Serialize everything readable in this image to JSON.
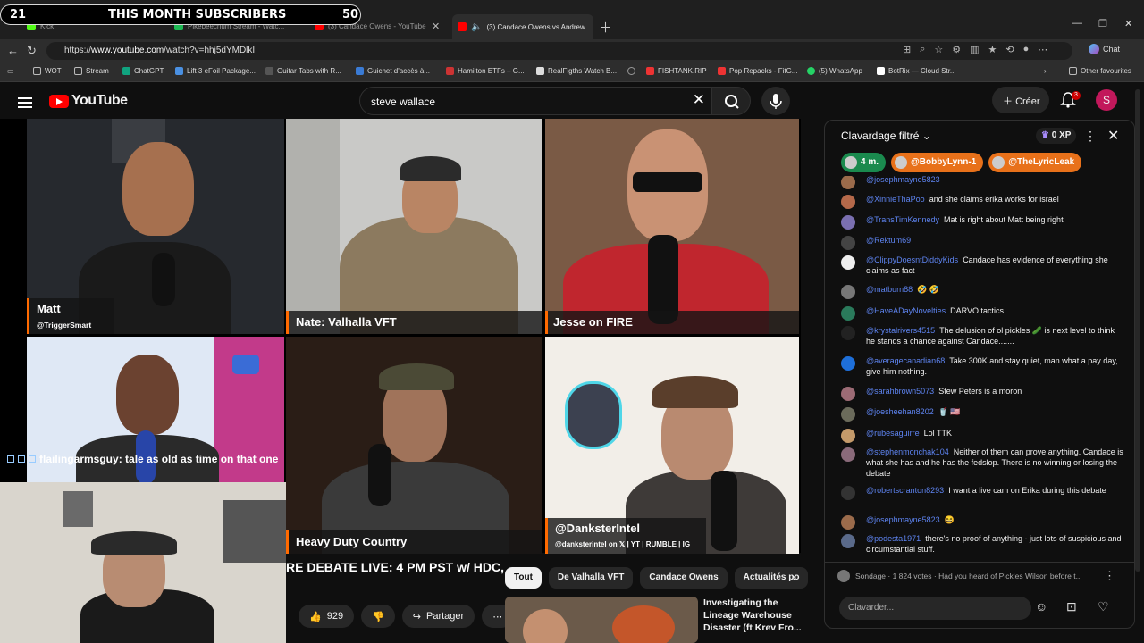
{
  "subscriber_overlay": {
    "left_count": "21",
    "title": "THIS MONTH SUBSCRIBERS",
    "right_count": "50"
  },
  "tabs": [
    {
      "label": "Kick",
      "fav_color": "#53fc18"
    },
    {
      "label": "Pikebeechum Stream - Watc...",
      "fav_color": "#1db954"
    },
    {
      "label": "(3) Candace Owens - YouTube",
      "fav_color": "#ff0000"
    },
    {
      "label": "(3) Candace Owens vs Andrew...",
      "fav_color": "#ff0000"
    }
  ],
  "address_bar": {
    "url_prefix": "https://",
    "url_site": "www.youtube.com",
    "url_rest": "/watch?v=hhj5dYMDlkI",
    "chat_label": "Chat"
  },
  "bookmarks": [
    {
      "label": "WOT",
      "color": "#888"
    },
    {
      "label": "Stream",
      "color": "#888"
    },
    {
      "label": "ChatGPT",
      "color": "#10a37f"
    },
    {
      "label": "Lift 3 eFoil Package...",
      "color": "#4a90e2"
    },
    {
      "label": "Guitar Tabs with R...",
      "color": "#444"
    },
    {
      "label": "Guichet d'accès à...",
      "color": "#3a7bd5"
    },
    {
      "label": "Hamilton ETFs – G...",
      "color": "#c33"
    },
    {
      "label": "RealFigths Watch B...",
      "color": "#ddd"
    },
    {
      "label": "",
      "color": "#999"
    },
    {
      "label": "FISHTANK.RIP",
      "color": "#e33"
    },
    {
      "label": "Pop Repacks - FitG...",
      "color": "#e33"
    },
    {
      "label": "(5) WhatsApp",
      "color": "#25d366"
    },
    {
      "label": "BotRix — Cloud Str...",
      "color": "#fff"
    }
  ],
  "bookmarks_other": "Other favourites",
  "youtube": {
    "logo": "YouTube",
    "search_value": "steve wallace",
    "create_label": "Créer",
    "notif_count": "3",
    "avatar_letter": "S"
  },
  "video": {
    "tiles": [
      {
        "name": "Matt",
        "handle": "@TriggerSmart"
      },
      {
        "name": "Nate: Valhalla VFT",
        "handle": ""
      },
      {
        "name": "Jesse on FIRE",
        "handle": ""
      },
      {
        "name": "",
        "handle": ""
      },
      {
        "name": "Heavy Duty Country",
        "handle": ""
      },
      {
        "name": "@DanksterIntel",
        "handle": "@danksterintel on 𝕏 | YT | RUMBLE | IG"
      }
    ],
    "tile4_caption": "flailingarmsguy: tale as old as time on that one",
    "title": "RE DEBATE LIVE: 4 PM PST w/ HDC,",
    "likes": "929",
    "share": "Partager"
  },
  "chips": [
    "Tout",
    "De Valhalla VFT",
    "Candace Owens",
    "Actualités po"
  ],
  "recommendation": {
    "title": "Investigating the Lineage Warehouse Disaster (ft",
    "extra": "Krev Fro..."
  },
  "chat": {
    "title": "Clavardage filtré",
    "xp": "0 XP",
    "pins": [
      {
        "label": "4 m.",
        "color": "#1a8a4e"
      },
      {
        "label": "@BobbyLynn-1",
        "color": "#e8711a"
      },
      {
        "label": "@TheLyricLeak",
        "color": "#e8711a"
      }
    ],
    "messages": [
      {
        "author": "@josephmayne5823",
        "text": "",
        "color": "#9b6b4b"
      },
      {
        "author": "@XinnieThaPoo",
        "text": "and she claims erika works for israel",
        "color": "#b5694a"
      },
      {
        "author": "@TransTimKennedy",
        "text": "Mat is right about Matt being right",
        "color": "#7a6fb0"
      },
      {
        "author": "@Rektum69",
        "text": "",
        "color": "#444"
      },
      {
        "author": "@ClippyDoesntDiddyKids",
        "text": "Candace has evidence of everything she claims as fact",
        "color": "#eee"
      },
      {
        "author": "@matburn88",
        "text": "🤣 🤣",
        "color": "#777"
      },
      {
        "author": "@HaveADayNovelties",
        "text": "DARVO tactics",
        "color": "#2a7a5b"
      },
      {
        "author": "@krystalrivers4515",
        "text": "The delusion of ol pickles 🥒 is next level to think he stands a chance against Candace.......",
        "color": "#222"
      },
      {
        "author": "@averagecanadian68",
        "text": "Take 300K and stay quiet, man what a pay day, give him nothing.",
        "color": "#1e6fd9"
      },
      {
        "author": "@sarahbrown5073",
        "text": "Stew Peters is a moron",
        "color": "#9c6b75"
      },
      {
        "author": "@joesheehan8202",
        "text": "🥤 🇺🇸",
        "color": "#6b6b5b"
      },
      {
        "author": "@rubesaguirre",
        "text": "Lol TTK",
        "color": "#c49a6a"
      },
      {
        "author": "@stephenmonchak104",
        "text": "Neither of them can prove anything. Candace is what she has and he has the fedslop. There is no winning or losing the debate",
        "color": "#8a6a7a"
      },
      {
        "author": "@robertscranton8293",
        "text": "I want a live cam on Erika during this debate",
        "color": "#333"
      },
      {
        "author": "@josephmayne5823",
        "text": "😆",
        "color": "#9b6b4b"
      },
      {
        "author": "@podesta1971",
        "text": "there's no proof of anything - just lots of suspicious and circumstantial stuff.",
        "color": "#5a6a8a"
      }
    ],
    "poll": "Sondage · 1 824 votes · Had you heard of Pickles Wilson before t...",
    "input_placeholder": "Clavarder..."
  }
}
